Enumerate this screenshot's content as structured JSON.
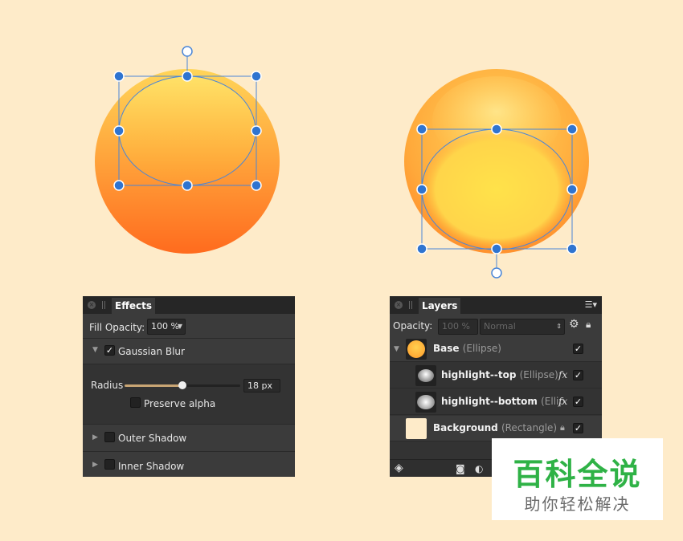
{
  "effects_panel": {
    "tab_label": "Effects",
    "fill_opacity_label": "Fill Opacity:",
    "fill_opacity_value": "100 %",
    "gaussian_blur": {
      "label": "Gaussian Blur",
      "checked": "✓"
    },
    "radius_label": "Radius",
    "radius_value": "18 px",
    "radius_fraction": 0.5,
    "preserve_alpha_label": "Preserve alpha",
    "outer_shadow_label": "Outer Shadow",
    "inner_shadow_label": "Inner Shadow"
  },
  "layers_panel": {
    "tab_label": "Layers",
    "opacity_label": "Opacity:",
    "opacity_value": "100 %",
    "blend_mode": "Normal",
    "layers": [
      {
        "name": "Base",
        "type": "(Ellipse)",
        "visible": "✓"
      },
      {
        "name": "highlight--top",
        "type": "(Ellipse)",
        "fx": "fx",
        "visible": "✓"
      },
      {
        "name": "highlight--bottom",
        "type": "(Ellip",
        "fx": "fx",
        "visible": "✓"
      },
      {
        "name": "Background",
        "type": "(Rectangle)",
        "visible": "✓"
      }
    ]
  },
  "watermark": {
    "title": "百科全说",
    "subtitle": "助你轻松解决"
  },
  "colors": {
    "background": "#feebc9",
    "panel": "#3b3b3b",
    "handle": "#2f74d0",
    "watermark_green": "#2fb246"
  }
}
